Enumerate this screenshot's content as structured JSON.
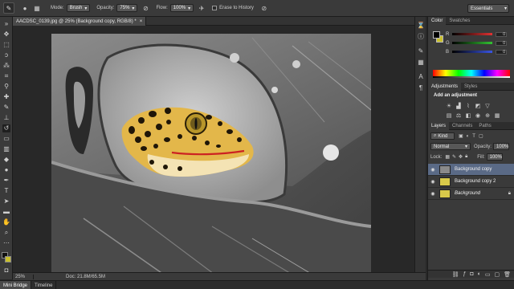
{
  "options_bar": {
    "tool_icon": "brush-icon",
    "mode_label": "Mode:",
    "mode_value": "Brush",
    "opacity_label": "Opacity:",
    "opacity_value": "75%",
    "flow_label": "Flow:",
    "flow_value": "100%",
    "erase_label": "Erase to History",
    "workspace": "Essentials"
  },
  "document": {
    "tab_title": "AACDSC_0139.jpg @ 25% (Background copy, RGB/8) *",
    "zoom": "25%",
    "doc_size": "Doc: 21.8M/65.5M"
  },
  "bottom_tabs": [
    "Mini Bridge",
    "Timeline"
  ],
  "color_panel": {
    "tabs": [
      "Color",
      "Swatches"
    ],
    "sliders": [
      {
        "channel": "R",
        "value": "0",
        "color": "#d23a3a"
      },
      {
        "channel": "G",
        "value": "0",
        "color": "#35b33a"
      },
      {
        "channel": "B",
        "value": "0",
        "color": "#3a55d2"
      }
    ],
    "fg_color": "#000000",
    "bg_color": "#c9c02c"
  },
  "adjustments_panel": {
    "tabs": [
      "Adjustments",
      "Styles"
    ],
    "title": "Add an adjustment"
  },
  "layers_panel": {
    "tabs": [
      "Layers",
      "Channels",
      "Paths"
    ],
    "kind_label": "Kind",
    "blend_mode": "Normal",
    "opacity_label": "Opacity:",
    "opacity_value": "100%",
    "lock_label": "Lock:",
    "fill_label": "Fill:",
    "fill_value": "100%",
    "layers": [
      {
        "name": "Background copy",
        "selected": true,
        "italic": false
      },
      {
        "name": "Background copy 2",
        "selected": false,
        "italic": false
      },
      {
        "name": "Background",
        "selected": false,
        "italic": true
      }
    ]
  },
  "colors": {
    "selection": "#5a6a86",
    "accent_yellow": "#c9c02c"
  }
}
